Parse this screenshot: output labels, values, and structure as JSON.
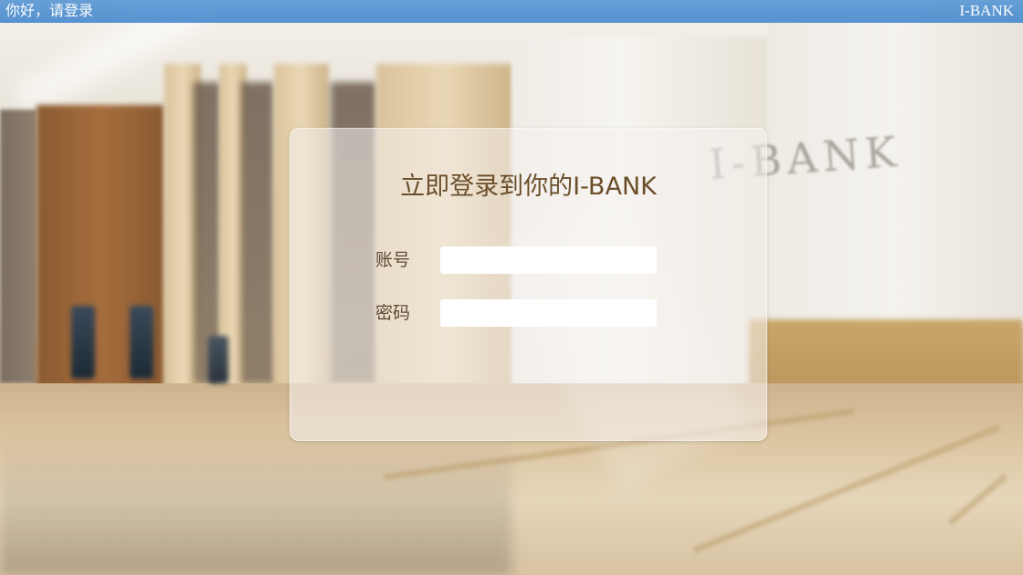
{
  "topbar": {
    "greeting": "你好，请登录",
    "brand": "I-BANK"
  },
  "background": {
    "wall_logo": "I-BANK"
  },
  "login": {
    "title": "立即登录到你的I-BANK",
    "account_label": "账号",
    "account_value": "",
    "password_label": "密码",
    "password_value": ""
  },
  "colors": {
    "topbar": "#4a8bd0",
    "title_text": "#6b4e2a",
    "label_text": "#5e4a35"
  }
}
